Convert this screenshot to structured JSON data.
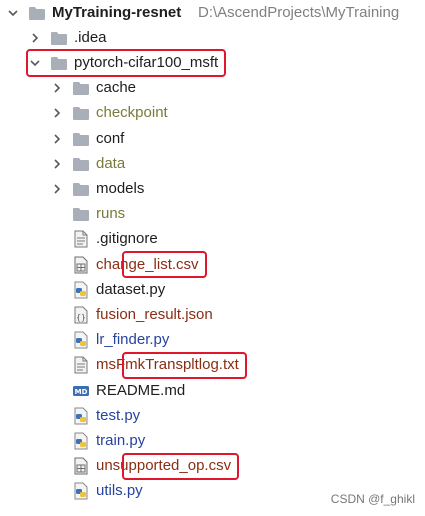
{
  "project_tree": {
    "root": {
      "label": "MyTraining-resnet",
      "path": "D:\\AscendProjects\\MyTraining"
    },
    "items": [
      {
        "key": "idea",
        "label": ".idea",
        "type": "folder",
        "expand": "collapsed",
        "color": "normal",
        "icon": "folder-icon"
      },
      {
        "key": "pytorch_cifar100_msft",
        "label": "pytorch-cifar100_msft",
        "type": "folder",
        "expand": "expanded",
        "color": "normal",
        "icon": "folder-icon"
      },
      {
        "key": "cache",
        "label": "cache",
        "type": "folder",
        "expand": "collapsed",
        "color": "normal",
        "icon": "folder-icon"
      },
      {
        "key": "checkpoint",
        "label": "checkpoint",
        "type": "folder",
        "expand": "collapsed",
        "color": "excluded",
        "icon": "folder-icon"
      },
      {
        "key": "conf",
        "label": "conf",
        "type": "folder",
        "expand": "collapsed",
        "color": "normal",
        "icon": "folder-icon"
      },
      {
        "key": "data",
        "label": "data",
        "type": "folder",
        "expand": "collapsed",
        "color": "excluded",
        "icon": "folder-icon"
      },
      {
        "key": "models",
        "label": "models",
        "type": "folder",
        "expand": "collapsed",
        "color": "normal",
        "icon": "folder-icon"
      },
      {
        "key": "runs",
        "label": "runs",
        "type": "folder",
        "expand": "none",
        "color": "excluded",
        "icon": "folder-icon"
      },
      {
        "key": "gitignore",
        "label": ".gitignore",
        "type": "file",
        "expand": "none",
        "color": "normal",
        "icon": "text-file-icon"
      },
      {
        "key": "change_list",
        "label": "change_list.csv",
        "type": "file",
        "expand": "none",
        "color": "modified",
        "icon": "csv-file-icon"
      },
      {
        "key": "dataset_py",
        "label": "dataset.py",
        "type": "file",
        "expand": "none",
        "color": "normal",
        "icon": "python-file-icon"
      },
      {
        "key": "fusion_result",
        "label": "fusion_result.json",
        "type": "file",
        "expand": "none",
        "color": "modified",
        "icon": "json-file-icon"
      },
      {
        "key": "lr_finder",
        "label": "lr_finder.py",
        "type": "file",
        "expand": "none",
        "color": "python",
        "icon": "python-file-icon"
      },
      {
        "key": "msfmk_log",
        "label": "msFmkTranspltlog.txt",
        "type": "file",
        "expand": "none",
        "color": "modified",
        "icon": "text-file-icon"
      },
      {
        "key": "readme",
        "label": "README.md",
        "type": "file",
        "expand": "none",
        "color": "normal",
        "icon": "markdown-file-icon"
      },
      {
        "key": "test_py",
        "label": "test.py",
        "type": "file",
        "expand": "none",
        "color": "python",
        "icon": "python-file-icon"
      },
      {
        "key": "train_py",
        "label": "train.py",
        "type": "file",
        "expand": "none",
        "color": "python",
        "icon": "python-file-icon"
      },
      {
        "key": "unsupported_op",
        "label": "unsupported_op.csv",
        "type": "file",
        "expand": "none",
        "color": "modified",
        "icon": "csv-file-icon"
      },
      {
        "key": "utils_py",
        "label": "utils.py",
        "type": "file",
        "expand": "none",
        "color": "python",
        "icon": "python-file-icon"
      }
    ],
    "highlighted": [
      "pytorch_cifar100_msft",
      "change_list",
      "msfmk_log",
      "unsupported_op"
    ]
  },
  "colors": {
    "normal": "#1e1e1e",
    "excluded": "#7a7a3a",
    "modified": "#8b2d14",
    "python": "#2743a0",
    "highlight": "#e0162b"
  },
  "watermark": "CSDN @f_ghikl"
}
